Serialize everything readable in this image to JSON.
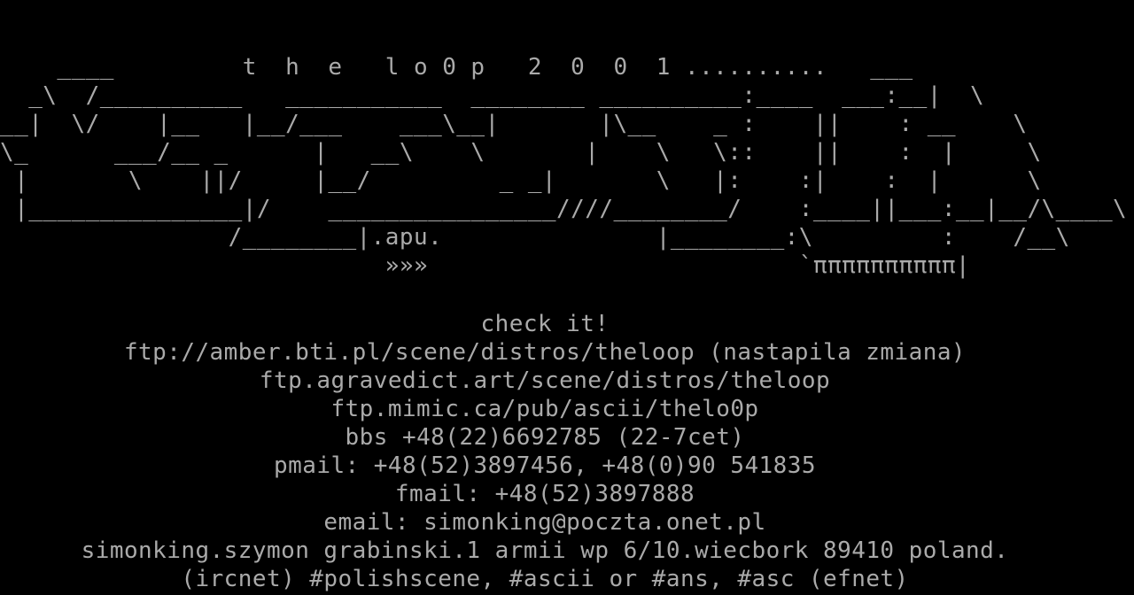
{
  "screen": {
    "background": "#000000",
    "foreground": "#aaaaaa"
  },
  "ascii_art": "    ____         t  h  e   l o 0 p   2  0  0  1 ..........   ___\n  _\\  /__________   ___________  ________ __________:____  ___:__|  \\\n__|  \\/    |__   |__/___    ___\\__|       |\\__    _ :    ||    : __    \\\n\\_      ___/__ _      |   __\\    \\       |    \\   \\::    ||    :  |     \\\n |       \\    ||/     |__/         _ _|       \\   |:    :|    :  |      \\\n |_______________|/    ________________////________/    :____||___:__|__/\\____\\\n                /________|.apu.               |________:\\         :    /__\\\n                           »»»                          `ππππππππππ|",
  "info_lines": [
    "check it!",
    "ftp://amber.bti.pl/scene/distros/theloop (nastapila zmiana)",
    "ftp.agravedict.art/scene/distros/theloop",
    "ftp.mimic.ca/pub/ascii/thelo0p",
    "bbs +48(22)6692785 (22-7cet)",
    "pmail: +48(52)3897456, +48(0)90 541835",
    "fmail: +48(52)3897888",
    "email: simonking@poczta.onet.pl",
    "simonking.szymon grabinski.1 armii wp 6/10.wiecbork 89410 poland.",
    "(ircnet) #polishscene, #ascii or #ans, #asc (efnet)"
  ]
}
